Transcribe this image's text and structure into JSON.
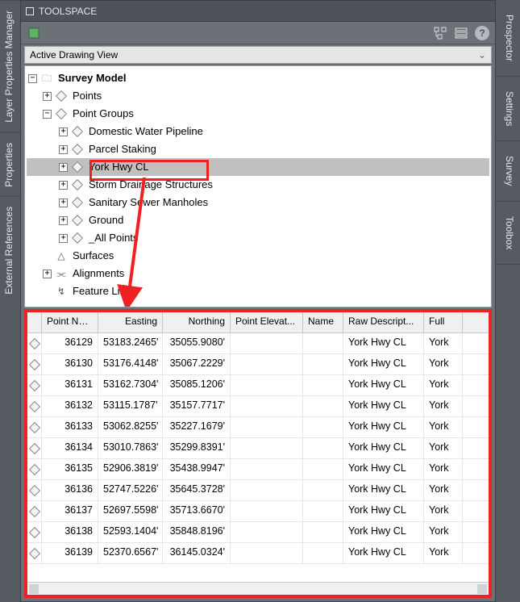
{
  "window": {
    "title": "TOOLSPACE"
  },
  "view_dropdown": {
    "label": "Active Drawing View"
  },
  "help_label": "?",
  "left_tabs": [
    "Layer Properties Manager",
    "Properties",
    "External References"
  ],
  "right_tabs": [
    "Prospector",
    "Settings",
    "Survey",
    "Toolbox"
  ],
  "tree": {
    "root": "Survey Model",
    "points": "Points",
    "point_groups": "Point Groups",
    "pg": [
      "Domestic Water Pipeline",
      "Parcel Staking",
      "York Hwy CL",
      "Storm Drainage Structures",
      "Sanitary Sewer Manholes",
      "Ground",
      "_All Points"
    ],
    "surfaces": "Surfaces",
    "alignments": "Alignments",
    "feature_lines": "Feature Lines"
  },
  "grid": {
    "headers": {
      "num": "Point Num...",
      "east": "Easting",
      "north": "Northing",
      "elev": "Point Elevat...",
      "name": "Name",
      "raw": "Raw Descript...",
      "full": "Full "
    },
    "rows": [
      {
        "num": "36129",
        "east": "53183.2465'",
        "north": "35055.9080'",
        "elev": "",
        "name": "",
        "raw": "York Hwy CL",
        "full": "York"
      },
      {
        "num": "36130",
        "east": "53176.4148'",
        "north": "35067.2229'",
        "elev": "",
        "name": "",
        "raw": "York Hwy CL",
        "full": "York"
      },
      {
        "num": "36131",
        "east": "53162.7304'",
        "north": "35085.1206'",
        "elev": "",
        "name": "",
        "raw": "York Hwy CL",
        "full": "York"
      },
      {
        "num": "36132",
        "east": "53115.1787'",
        "north": "35157.7717'",
        "elev": "",
        "name": "",
        "raw": "York Hwy CL",
        "full": "York"
      },
      {
        "num": "36133",
        "east": "53062.8255'",
        "north": "35227.1679'",
        "elev": "",
        "name": "",
        "raw": "York Hwy CL",
        "full": "York"
      },
      {
        "num": "36134",
        "east": "53010.7863'",
        "north": "35299.8391'",
        "elev": "",
        "name": "",
        "raw": "York Hwy CL",
        "full": "York"
      },
      {
        "num": "36135",
        "east": "52906.3819'",
        "north": "35438.9947'",
        "elev": "",
        "name": "",
        "raw": "York Hwy CL",
        "full": "York"
      },
      {
        "num": "36136",
        "east": "52747.5226'",
        "north": "35645.3728'",
        "elev": "",
        "name": "",
        "raw": "York Hwy CL",
        "full": "York"
      },
      {
        "num": "36137",
        "east": "52697.5598'",
        "north": "35713.6670'",
        "elev": "",
        "name": "",
        "raw": "York Hwy CL",
        "full": "York"
      },
      {
        "num": "36138",
        "east": "52593.1404'",
        "north": "35848.8196'",
        "elev": "",
        "name": "",
        "raw": "York Hwy CL",
        "full": "York"
      },
      {
        "num": "36139",
        "east": "52370.6567'",
        "north": "36145.0324'",
        "elev": "",
        "name": "",
        "raw": "York Hwy CL",
        "full": "York"
      }
    ]
  },
  "annotation": {
    "highlight_color": "#ee2222",
    "highlight_tree_node": "York Hwy CL",
    "arrow_from": "selected-tree-node",
    "arrow_to": "points-grid"
  }
}
